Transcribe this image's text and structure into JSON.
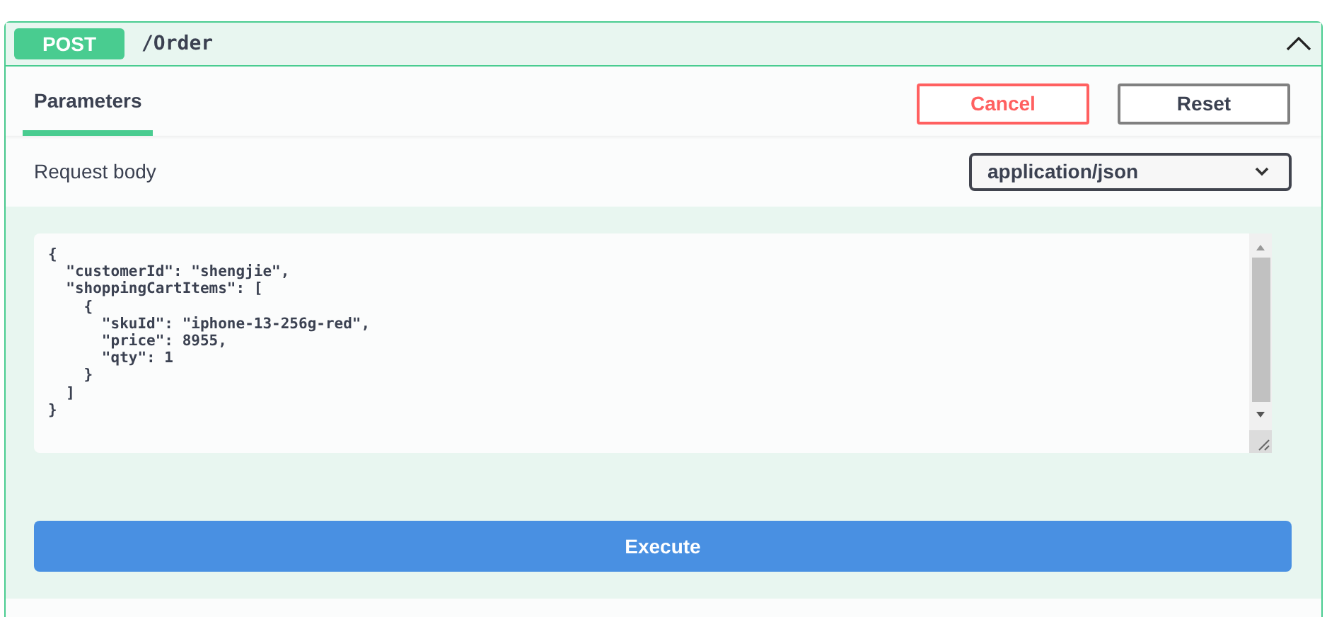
{
  "operation": {
    "method": "POST",
    "path": "/Order"
  },
  "tabs": [
    {
      "label": "Parameters",
      "selected": true
    }
  ],
  "buttons": [
    "Cancel",
    "Reset"
  ],
  "request_body": {
    "label": "Request body",
    "content_type": "application/json",
    "value": "{\n  \"customerId\": \"shengjie\",\n  \"shoppingCartItems\": [\n    {\n      \"skuId\": \"iphone-13-256g-red\",\n      \"price\": 8955,\n      \"qty\": 1\n    }\n  ]\n}"
  },
  "execute": "Execute"
}
